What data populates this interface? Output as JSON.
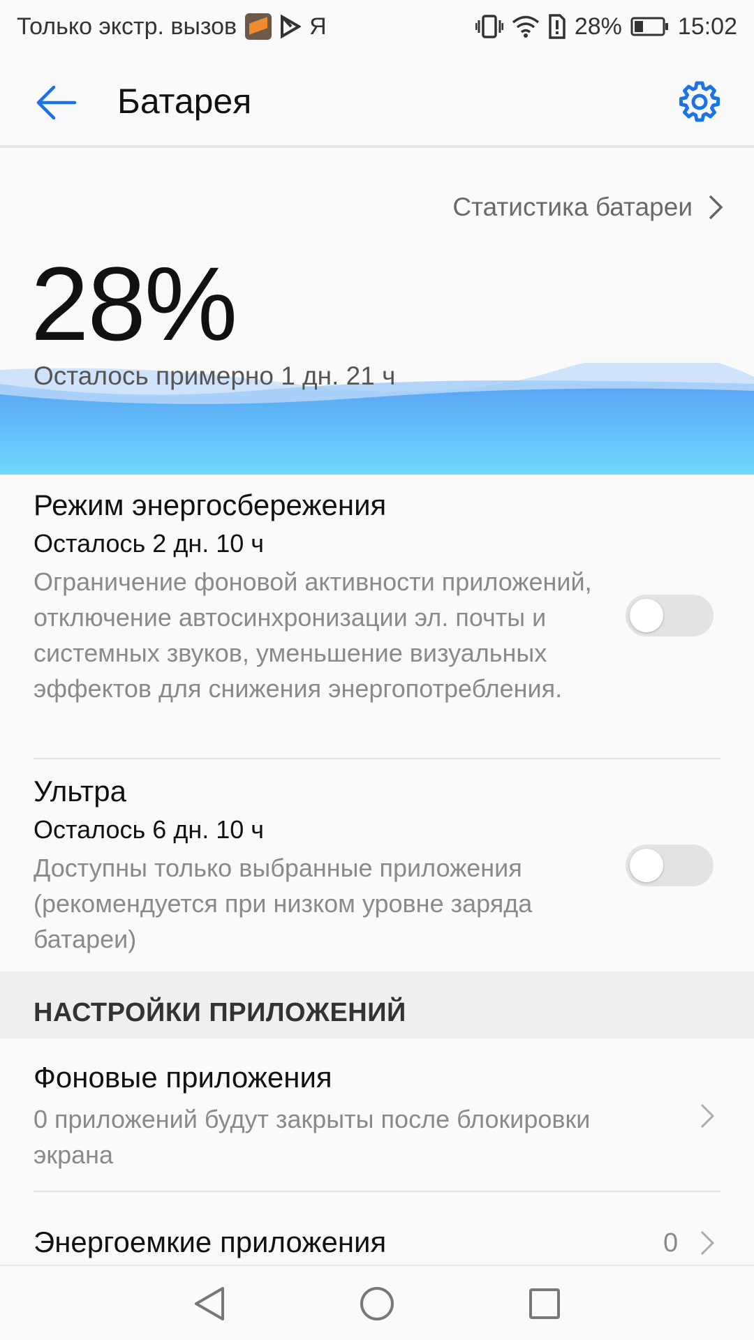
{
  "status_bar": {
    "carrier_text": "Только экстр. вызов",
    "battery_percent": "28%",
    "time": "15:02",
    "icons": [
      "app-icon",
      "play-icon",
      "yandex-icon",
      "vibrate-icon",
      "wifi-icon",
      "alert-icon",
      "battery-icon"
    ],
    "yandex_letter": "Я"
  },
  "header": {
    "title": "Батарея"
  },
  "battery": {
    "stats_link": "Статистика батареи",
    "percent": "28%",
    "level": 0.28,
    "remaining": "Осталось примерно 1 дн. 21 ч",
    "wave_colors": [
      "#5aa7f5",
      "#6fd8fb"
    ]
  },
  "power_saving": {
    "title": "Режим энергосбережения",
    "remaining": "Осталось 2 дн. 10 ч",
    "description": "Ограничение фоновой активности приложений, отключение автосинхронизации эл. почты и системных звуков, уменьшение визуальных эффектов для снижения энергопотребления.",
    "enabled": false
  },
  "ultra": {
    "title": "Ультра",
    "remaining": "Осталось 6 дн. 10 ч",
    "description": "Доступны только выбранные приложения (рекомендуется при низком уровне заряда батареи)",
    "enabled": false
  },
  "app_settings": {
    "section_title": "НАСТРОЙКИ ПРИЛОЖЕНИЙ",
    "background_apps": {
      "title": "Фоновые приложения",
      "description": "0 приложений будут закрыты после блокировки экрана"
    },
    "power_intensive": {
      "title": "Энергоемкие приложения",
      "count": "0"
    }
  },
  "accent_color": "#1a73e8"
}
